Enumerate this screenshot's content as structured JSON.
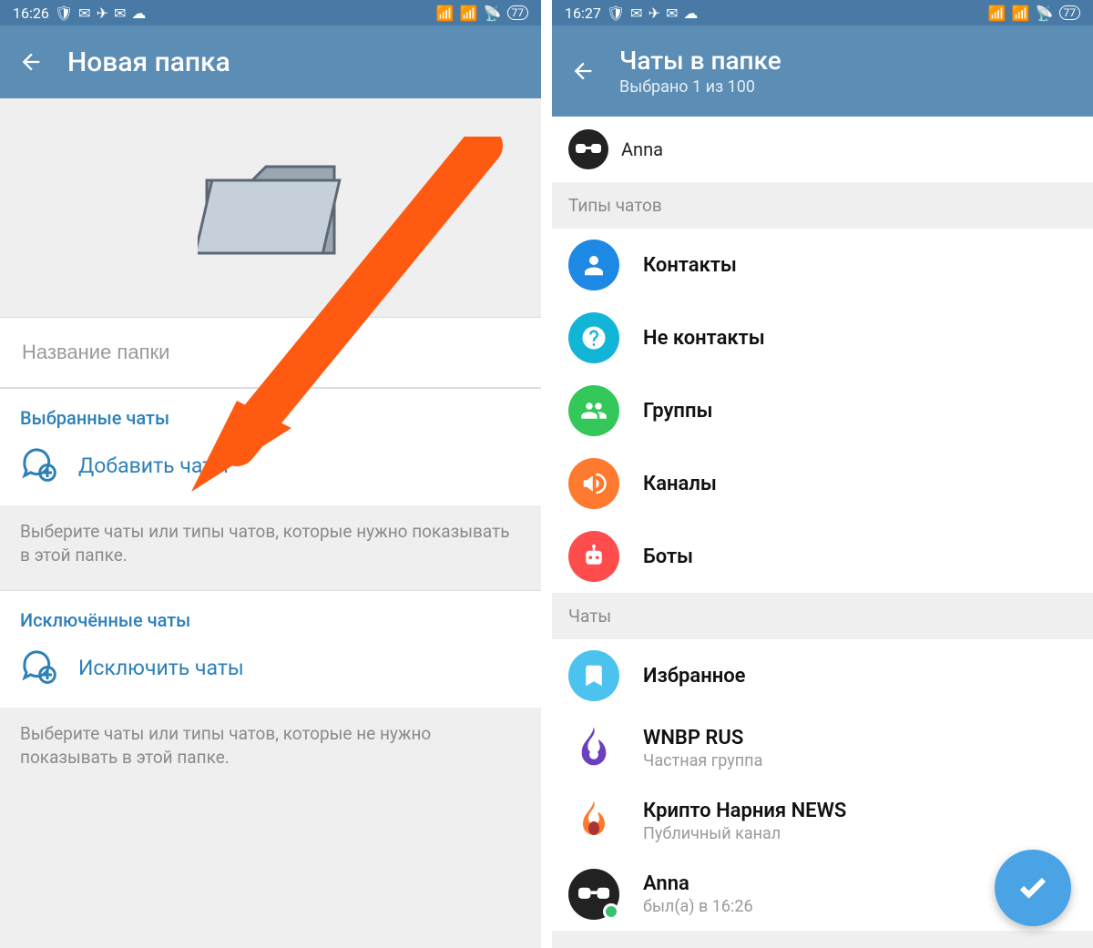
{
  "screen1": {
    "status": {
      "time": "16:26",
      "battery": "77"
    },
    "title": "Новая папка",
    "folder_name_placeholder": "Название папки",
    "selected": {
      "header": "Выбранные чаты",
      "action": "Добавить чаты",
      "help": "Выберите чаты или типы чатов, которые нужно показывать в этой папке."
    },
    "excluded": {
      "header": "Исключённые чаты",
      "action": "Исключить чаты",
      "help": "Выберите чаты или типы чатов, которые не нужно показывать в этой папке."
    }
  },
  "screen2": {
    "status": {
      "time": "16:27",
      "battery": "77"
    },
    "title": "Чаты в папке",
    "subtitle": "Выбрано 1 из 100",
    "selected_chip": {
      "name": "Anna"
    },
    "section_types_label": "Типы чатов",
    "types": [
      {
        "label": "Контакты",
        "color": "#1e88e5",
        "icon": "person"
      },
      {
        "label": "Не контакты",
        "color": "#13b5d6",
        "icon": "question"
      },
      {
        "label": "Группы",
        "color": "#34c759",
        "icon": "group"
      },
      {
        "label": "Каналы",
        "color": "#ff7a2e",
        "icon": "megaphone"
      },
      {
        "label": "Боты",
        "color": "#ff4d4d",
        "icon": "robot"
      }
    ],
    "section_chats_label": "Чаты",
    "chats": [
      {
        "title": "Избранное",
        "subtitle": "",
        "avatar_color": "#4cc3ef",
        "icon": "bookmark"
      },
      {
        "title": "WNBP RUS",
        "subtitle": "Частная группа",
        "avatar_color": "#ffffff",
        "icon": "flame-purple"
      },
      {
        "title": "Крипто Нарния NEWS",
        "subtitle": "Публичный канал",
        "avatar_color": "#ffffff",
        "icon": "flame-orange"
      },
      {
        "title": "Anna",
        "subtitle": "был(а) в 16:26",
        "avatar_color": "#222222",
        "icon": "avatar",
        "online": true
      }
    ]
  },
  "annotation": {
    "arrow_color": "#ff5a12"
  }
}
